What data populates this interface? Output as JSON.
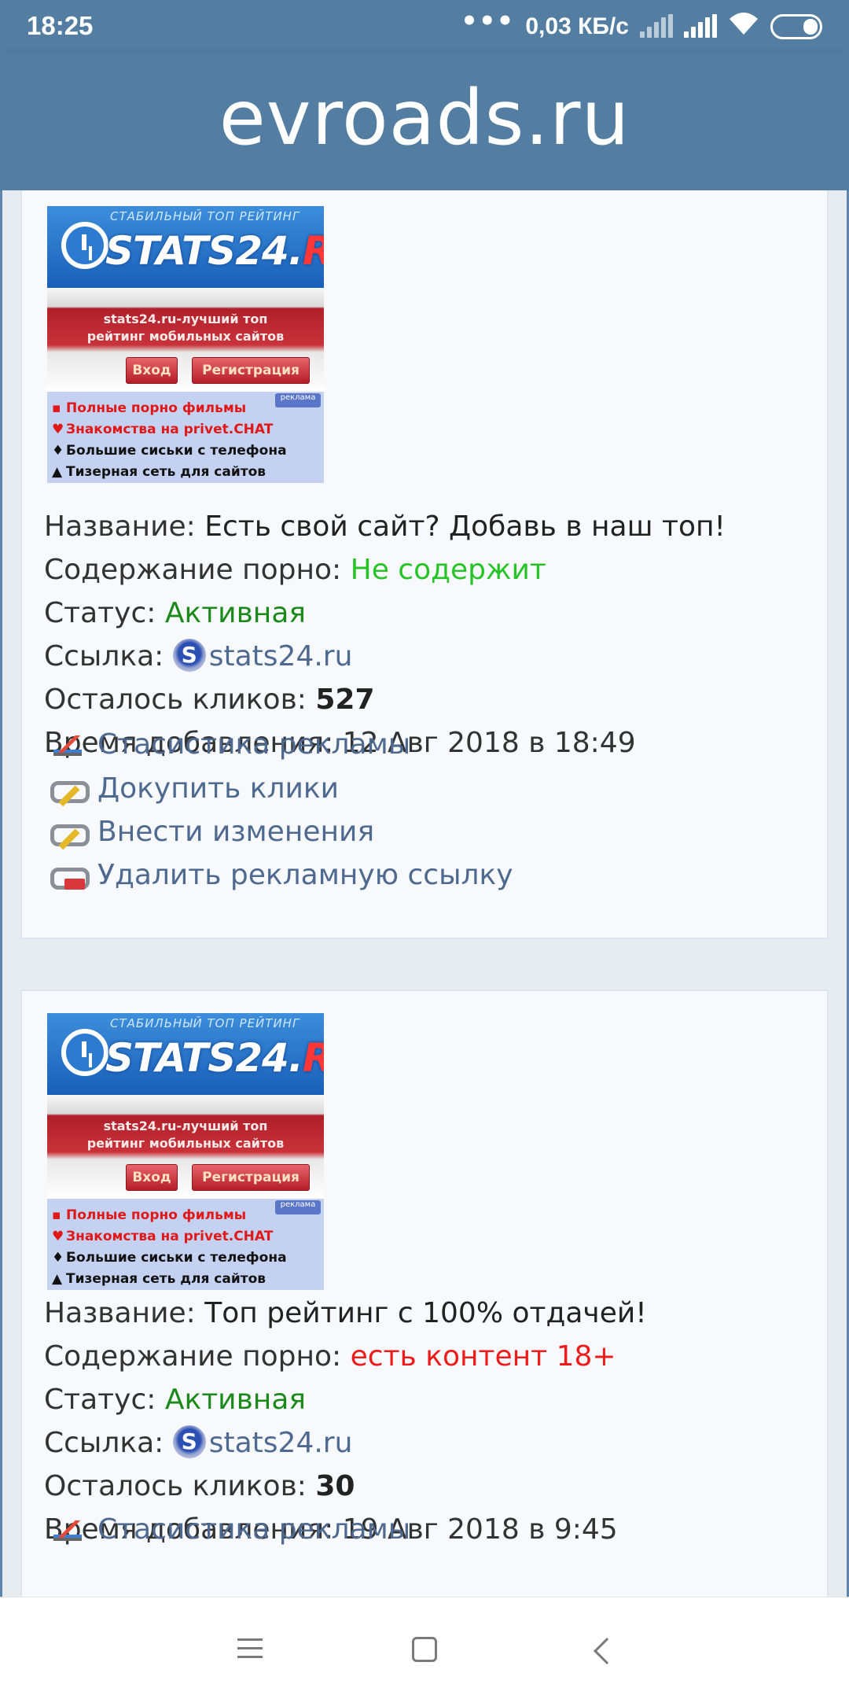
{
  "status_bar": {
    "time": "18:25",
    "dots": "•••",
    "net_speed": "0,03 КБ/с"
  },
  "header": {
    "title": "evroads.ru"
  },
  "colors": {
    "header_bg": "#537ea2",
    "link": "#4f6a90",
    "green": "#1b8a1b",
    "bright_green": "#27c427",
    "red": "#ee1b1b"
  },
  "banner": {
    "tagline": "СТАБИЛЬНЫЙ ТОП РЕЙТИНГ",
    "logo_main": "STATS24.",
    "logo_accent": "RU",
    "line1": "stats24.ru-лучший топ",
    "line2": "рейтинг мобильных сайтов",
    "btn_login": "Вход",
    "btn_register": "Регистрация",
    "ad_label": "реклама",
    "rows": [
      {
        "text": "Полные порно фильмы",
        "color": "#e01818"
      },
      {
        "text": "Знакомства на privet.CHAT",
        "color": "#e01818"
      },
      {
        "text": "Большие сиськи с телефона",
        "color": "#111111"
      },
      {
        "text": "Тизерная сеть для сайтов",
        "color": "#111111"
      }
    ]
  },
  "labels": {
    "name": "Название:",
    "porn": "Содержание порно:",
    "status": "Статус:",
    "link": "Ссылка:",
    "clicks": "Осталось кликов:",
    "added": "Время добавления:"
  },
  "ads": [
    {
      "name": "Есть свой сайт? Добавь в наш топ!",
      "porn": "Не содержит",
      "status": "Активная",
      "link": "stats24.ru",
      "clicks": "527",
      "added": "12 Авг 2018 в 18:49",
      "actions": [
        {
          "label": "Стасистика рекламы",
          "icon": "chart-icon"
        },
        {
          "label": "Докупить клики",
          "icon": "link-pencil-icon"
        },
        {
          "label": "Внести изменения",
          "icon": "link-pencil-icon"
        },
        {
          "label": "Удалить рекламную ссылку",
          "icon": "link-delete-icon"
        }
      ]
    },
    {
      "name": "Топ рейтинг с 100% отдачей!",
      "porn": "есть контент 18+",
      "status": "Активная",
      "link": "stats24.ru",
      "clicks": "30",
      "added": "19 Авг 2018 в 9:45",
      "actions": [
        {
          "label": "Стасистика рекламы",
          "icon": "chart-icon"
        }
      ]
    }
  ]
}
